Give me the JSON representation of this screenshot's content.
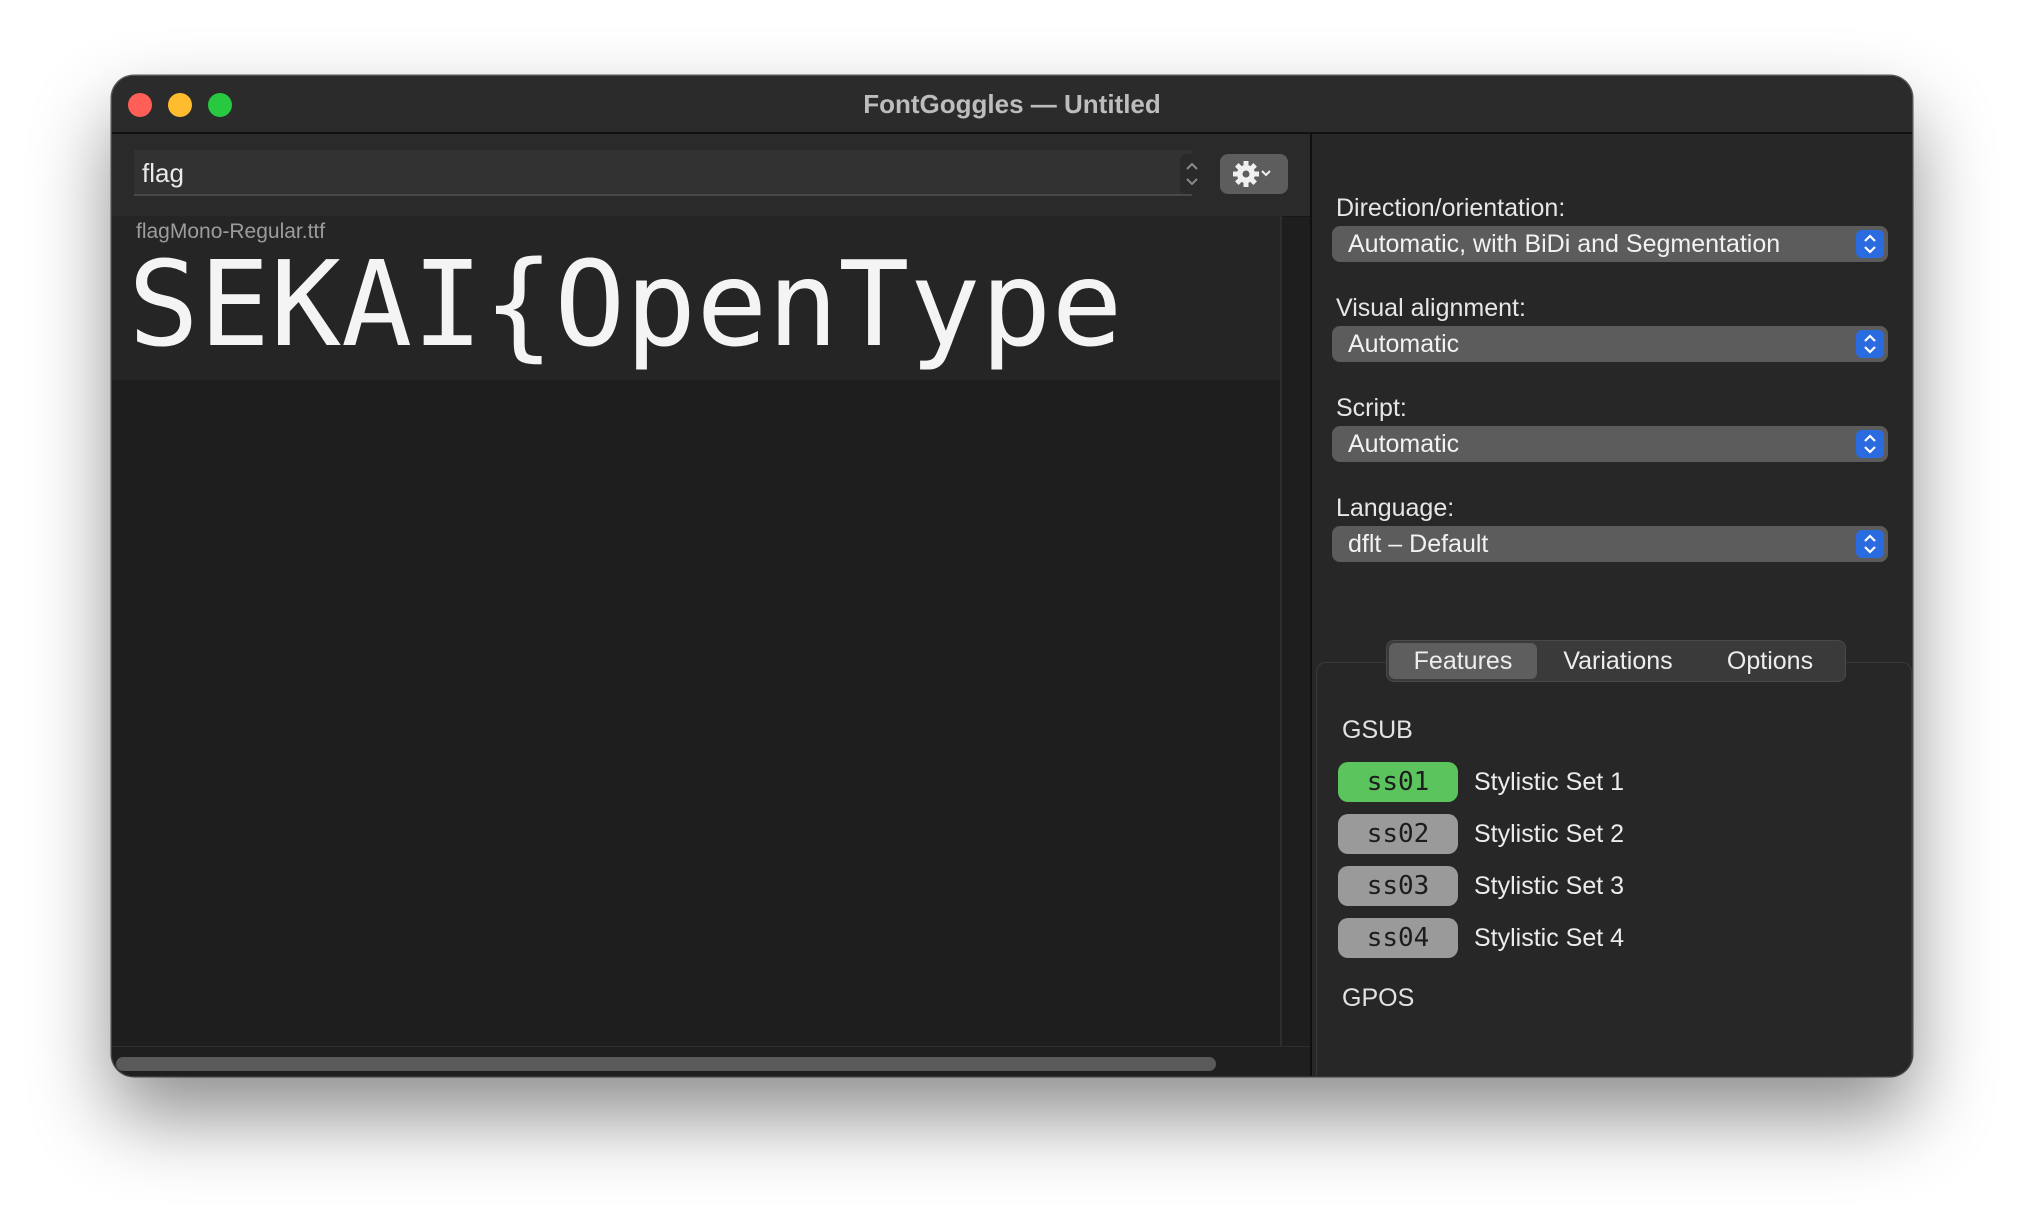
{
  "window": {
    "title": "FontGoggles — Untitled"
  },
  "toolbar": {
    "text_input_value": "flag"
  },
  "font_list": [
    {
      "file_name": "flagMono-Regular.ttf",
      "sample_text": "SEKAI{OpenType"
    }
  ],
  "sidebar": {
    "direction": {
      "label": "Direction/orientation:",
      "value": "Automatic, with BiDi and Segmentation"
    },
    "alignment": {
      "label": "Visual alignment:",
      "value": "Automatic"
    },
    "script": {
      "label": "Script:",
      "value": "Automatic"
    },
    "language": {
      "label": "Language:",
      "value": "dflt – Default"
    },
    "tabs": [
      {
        "label": "Features",
        "active": true
      },
      {
        "label": "Variations",
        "active": false
      },
      {
        "label": "Options",
        "active": false
      }
    ],
    "features": {
      "gsub_title": "GSUB",
      "gpos_title": "GPOS",
      "items": [
        {
          "tag": "ss01",
          "label": "Stylistic Set 1",
          "state": "on",
          "color": "#5cc45d"
        },
        {
          "tag": "ss02",
          "label": "Stylistic Set 2",
          "state": "default",
          "color": "#9a9a9a"
        },
        {
          "tag": "ss03",
          "label": "Stylistic Set 3",
          "state": "default",
          "color": "#9a9a9a"
        },
        {
          "tag": "ss04",
          "label": "Stylistic Set 4",
          "state": "default",
          "color": "#9a9a9a"
        }
      ]
    }
  },
  "colors": {
    "accent": "#2a6be0",
    "feature_on": "#5cc45d",
    "feature_default": "#9a9a9a"
  }
}
